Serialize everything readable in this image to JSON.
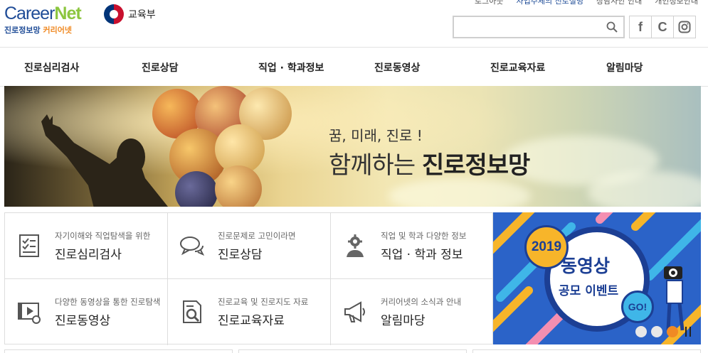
{
  "header": {
    "logo_en_a": "Career",
    "logo_en_b": "Net",
    "logo_ko_a": "진로정보망",
    "logo_ko_b": "커리어넷",
    "ministry": "교육부",
    "util_links": [
      "로그아웃",
      "사업주체의 진로설명",
      "상담사안 안내",
      "개인정보안내"
    ],
    "search": {
      "placeholder": "",
      "value": ""
    },
    "sns": [
      "f",
      "C",
      "◎"
    ]
  },
  "gnb": [
    "진로심리검사",
    "진로상담",
    "직업 · 학과정보",
    "진로동영상",
    "진로교육자료",
    "알림마당"
  ],
  "banner": {
    "line1": "꿈, 미래, 진로 !",
    "line2_a": "함께하는 ",
    "line2_b": "진로정보망"
  },
  "quick": [
    {
      "sub": "자기이해와 직업탐색을 위한",
      "main": "진로심리검사",
      "icon": "checklist-icon"
    },
    {
      "sub": "진로문제로 고민이라면",
      "main": "진로상담",
      "icon": "chat-bubbles-icon"
    },
    {
      "sub": "직업 및 학과 다양한 정보",
      "main": "직업 · 학과 정보",
      "icon": "worker-gear-icon"
    },
    {
      "sub": "다양한 동영상을 통한 진로탐색",
      "main": "진로동영상",
      "icon": "video-play-icon"
    },
    {
      "sub": "진로교육 및 진로지도 자료",
      "main": "진로교육자료",
      "icon": "document-search-icon"
    },
    {
      "sub": "커리어넷의 소식과 안내",
      "main": "알림마당",
      "icon": "megaphone-icon"
    }
  ],
  "event": {
    "year": "2019",
    "title": "동영상",
    "subtitle": "공모 이벤트",
    "go": "GO!"
  },
  "colors": {
    "brand_blue": "#1f4c97",
    "brand_green": "#8cc63f",
    "brand_orange": "#f08a24",
    "event_bg": "#2b63c8"
  }
}
